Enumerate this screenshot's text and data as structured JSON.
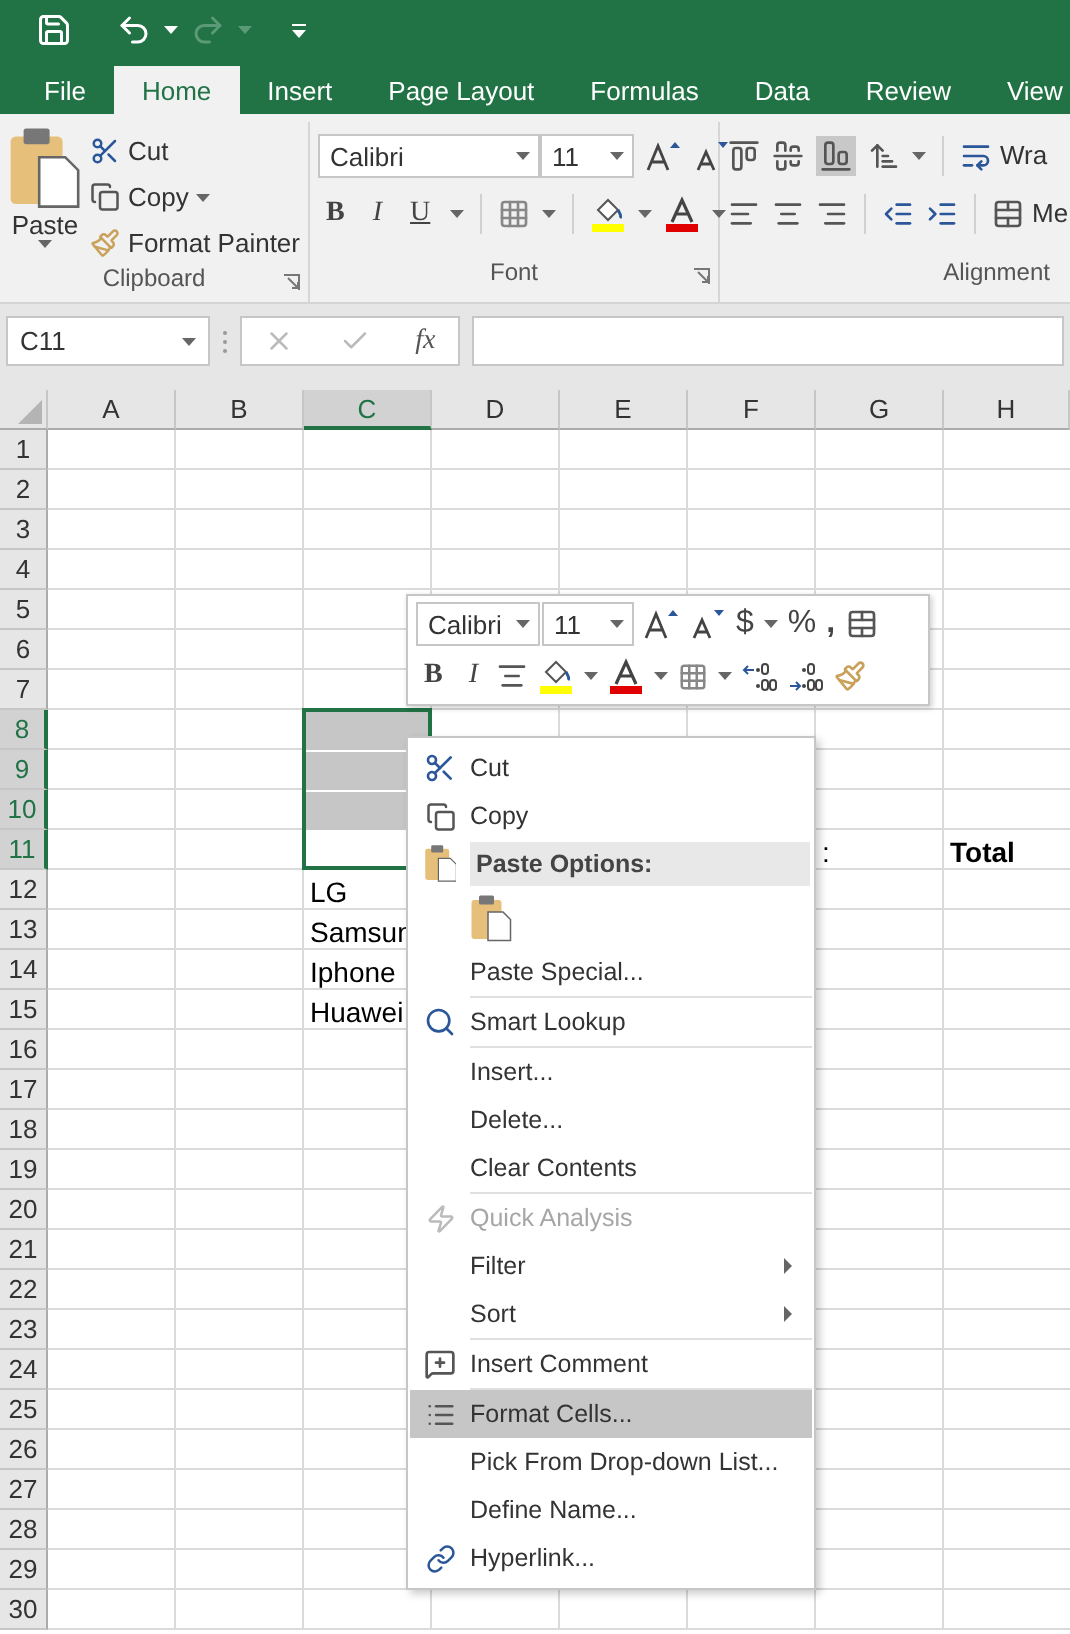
{
  "tabs": [
    {
      "label": "File",
      "selected": false
    },
    {
      "label": "Home",
      "selected": true
    },
    {
      "label": "Insert",
      "selected": false
    },
    {
      "label": "Page Layout",
      "selected": false
    },
    {
      "label": "Formulas",
      "selected": false
    },
    {
      "label": "Data",
      "selected": false
    },
    {
      "label": "Review",
      "selected": false
    },
    {
      "label": "View",
      "selected": false
    }
  ],
  "ribbon": {
    "clipboard": {
      "paste": "Paste",
      "cut": "Cut",
      "copy": "Copy",
      "format_painter": "Format Painter",
      "label": "Clipboard"
    },
    "font": {
      "font_name": "Calibri",
      "font_size": "11",
      "bold": "B",
      "italic": "I",
      "underline": "U",
      "label": "Font"
    },
    "alignment": {
      "wrap_text": "Wra",
      "merge": "Me",
      "label": "Alignment"
    }
  },
  "formula_bar": {
    "name_box": "C11",
    "function_label": "fx"
  },
  "columns": [
    {
      "label": "A",
      "selected": false
    },
    {
      "label": "B",
      "selected": false
    },
    {
      "label": "C",
      "selected": true
    },
    {
      "label": "D",
      "selected": false
    },
    {
      "label": "E",
      "selected": false
    },
    {
      "label": "F",
      "selected": false
    },
    {
      "label": "G",
      "selected": false
    },
    {
      "label": "H",
      "selected": false
    }
  ],
  "rows": [
    {
      "number": "1",
      "selected": false
    },
    {
      "number": "2",
      "selected": false
    },
    {
      "number": "3",
      "selected": false
    },
    {
      "number": "4",
      "selected": false
    },
    {
      "number": "5",
      "selected": false
    },
    {
      "number": "6",
      "selected": false
    },
    {
      "number": "7",
      "selected": false
    },
    {
      "number": "8",
      "selected": true
    },
    {
      "number": "9",
      "selected": true
    },
    {
      "number": "10",
      "selected": true
    },
    {
      "number": "11",
      "selected": true,
      "cells": [
        null,
        null,
        null,
        null,
        null,
        null,
        {
          "text": ":",
          "bold": false
        },
        {
          "text": "Total",
          "bold": true
        }
      ]
    },
    {
      "number": "12",
      "selected": false,
      "cells": [
        null,
        null,
        {
          "text": "LG",
          "bold": false
        }
      ]
    },
    {
      "number": "13",
      "selected": false,
      "cells": [
        null,
        null,
        {
          "text": "Samsun",
          "bold": false
        }
      ]
    },
    {
      "number": "14",
      "selected": false,
      "cells": [
        null,
        null,
        {
          "text": "Iphone",
          "bold": false
        }
      ]
    },
    {
      "number": "15",
      "selected": false,
      "cells": [
        null,
        null,
        {
          "text": "Huawei",
          "bold": false
        }
      ]
    },
    {
      "number": "16",
      "selected": false
    },
    {
      "number": "17",
      "selected": false
    },
    {
      "number": "18",
      "selected": false
    },
    {
      "number": "19",
      "selected": false
    },
    {
      "number": "20",
      "selected": false
    },
    {
      "number": "21",
      "selected": false
    },
    {
      "number": "22",
      "selected": false
    },
    {
      "number": "23",
      "selected": false
    },
    {
      "number": "24",
      "selected": false
    },
    {
      "number": "25",
      "selected": false
    },
    {
      "number": "26",
      "selected": false
    },
    {
      "number": "27",
      "selected": false
    },
    {
      "number": "28",
      "selected": false
    },
    {
      "number": "29",
      "selected": false
    },
    {
      "number": "30",
      "selected": false
    }
  ],
  "mini_toolbar": {
    "font_name": "Calibri",
    "font_size": "11",
    "currency": "$",
    "percent": "%",
    "comma": ",",
    "bold": "B",
    "italic": "I"
  },
  "context_menu": [
    {
      "kind": "item",
      "label": "Cut",
      "disabled": false,
      "selected": false
    },
    {
      "kind": "item",
      "label": "Copy",
      "disabled": false,
      "selected": false
    },
    {
      "kind": "header",
      "label": "Paste Options:"
    },
    {
      "kind": "paste_icons"
    },
    {
      "kind": "item",
      "label": "Paste Special...",
      "disabled": false,
      "selected": false
    },
    {
      "kind": "separator"
    },
    {
      "kind": "item",
      "label": "Smart Lookup",
      "disabled": false,
      "selected": false
    },
    {
      "kind": "separator"
    },
    {
      "kind": "item",
      "label": "Insert...",
      "disabled": false,
      "selected": false
    },
    {
      "kind": "item",
      "label": "Delete...",
      "disabled": false,
      "selected": false
    },
    {
      "kind": "item",
      "label": "Clear Contents",
      "disabled": false,
      "selected": false
    },
    {
      "kind": "separator"
    },
    {
      "kind": "item",
      "label": "Quick Analysis",
      "disabled": true,
      "selected": false
    },
    {
      "kind": "submenu",
      "label": "Filter",
      "disabled": false,
      "selected": false
    },
    {
      "kind": "submenu",
      "label": "Sort",
      "disabled": false,
      "selected": false
    },
    {
      "kind": "separator"
    },
    {
      "kind": "item",
      "label": "Insert Comment",
      "disabled": false,
      "selected": false
    },
    {
      "kind": "separator"
    },
    {
      "kind": "item",
      "label": "Format Cells...",
      "disabled": false,
      "selected": true
    },
    {
      "kind": "item",
      "label": "Pick From Drop-down List...",
      "disabled": false,
      "selected": false
    },
    {
      "kind": "item",
      "label": "Define Name...",
      "disabled": false,
      "selected": false
    },
    {
      "kind": "item",
      "label": "Hyperlink...",
      "disabled": false,
      "selected": false
    }
  ]
}
